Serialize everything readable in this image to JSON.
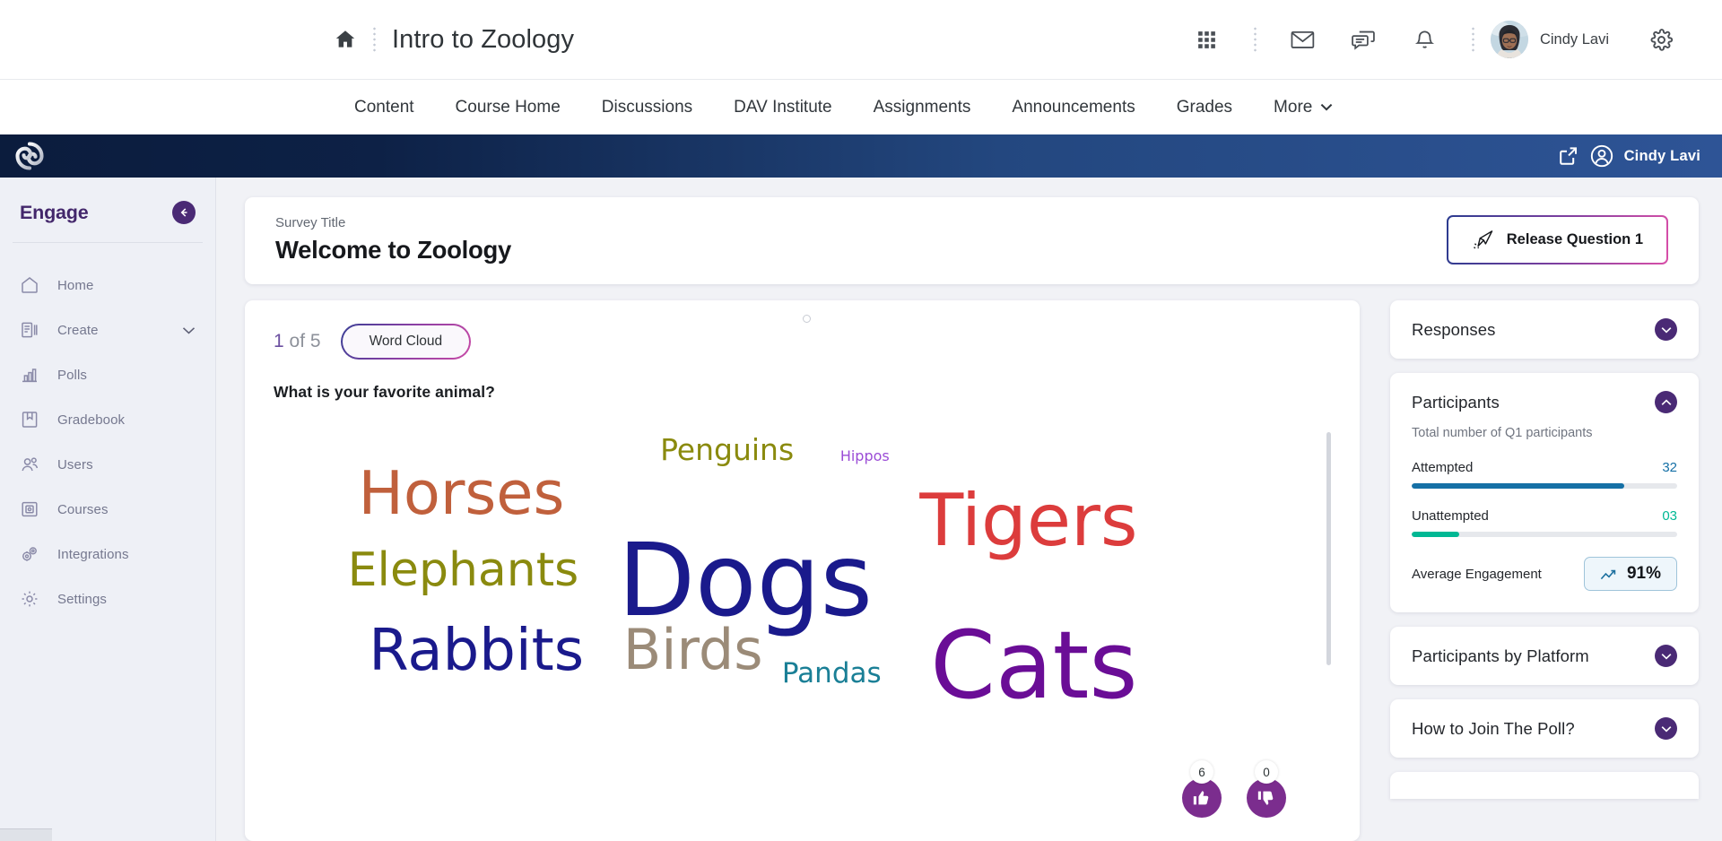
{
  "lms_header": {
    "home_icon": "home-icon",
    "course_title": "Intro to Zoology",
    "icons": [
      "waffle-grid-icon",
      "envelope-icon",
      "chat-bubbles-icon",
      "bell-icon"
    ],
    "user_name": "Cindy Lavi",
    "settings_icon": "gear-icon"
  },
  "nav": {
    "items": [
      {
        "label": "Content"
      },
      {
        "label": "Course Home"
      },
      {
        "label": "Discussions"
      },
      {
        "label": "DAV Institute"
      },
      {
        "label": "Assignments"
      },
      {
        "label": "Announcements"
      },
      {
        "label": "Grades"
      },
      {
        "label": "More"
      }
    ]
  },
  "engage_bar": {
    "logo": "engage-swirl-logo",
    "external_link_icon": "external-link-icon",
    "user_icon": "user-circle-icon",
    "user_name": "Cindy Lavi"
  },
  "sidebar": {
    "title": "Engage",
    "collapse_icon": "arrow-left-icon",
    "items": [
      {
        "label": "Home",
        "icon": "house-icon"
      },
      {
        "label": "Create",
        "icon": "create-document-icon",
        "chevron": true
      },
      {
        "label": "Polls",
        "icon": "bar-chart-icon"
      },
      {
        "label": "Gradebook",
        "icon": "book-bookmark-icon"
      },
      {
        "label": "Users",
        "icon": "users-icon"
      },
      {
        "label": "Courses",
        "icon": "courses-frame-icon"
      },
      {
        "label": "Integrations",
        "icon": "gears-icon"
      },
      {
        "label": "Settings",
        "icon": "gear-icon"
      }
    ]
  },
  "survey": {
    "label": "Survey Title",
    "name": "Welcome to Zoology",
    "release_button": "Release Question 1",
    "release_icon": "paper-plane-icon"
  },
  "question": {
    "index_current": "1",
    "index_rest": "of 5",
    "type_pill": "Word Cloud",
    "text": "What is your favorite animal?",
    "thumbs_up_count": "6",
    "thumbs_down_count": "0",
    "thumbs_up_icon": "thumbs-up-icon",
    "thumbs_down_icon": "thumbs-down-icon"
  },
  "chart_data": {
    "type": "wordcloud",
    "title": "What is your favorite animal?",
    "words": [
      {
        "text": "Dogs",
        "weight": 100,
        "color": "#1a1a8c",
        "size": 112,
        "x": 32.5,
        "y": 30
      },
      {
        "text": "Cats",
        "weight": 95,
        "color": "#6a0d96",
        "size": 104,
        "x": 62,
        "y": 51
      },
      {
        "text": "Tigers",
        "weight": 72,
        "color": "#dc3c3c",
        "size": 80,
        "x": 61,
        "y": 19
      },
      {
        "text": "Horses",
        "weight": 60,
        "color": "#c0603c",
        "size": 67,
        "x": 8,
        "y": 14
      },
      {
        "text": "Rabbits",
        "weight": 58,
        "color": "#1a1a8c",
        "size": 64,
        "x": 9,
        "y": 52
      },
      {
        "text": "Birds",
        "weight": 56,
        "color": "#9b8b78",
        "size": 62,
        "x": 33,
        "y": 52
      },
      {
        "text": "Elephants",
        "weight": 48,
        "color": "#8a8a0e",
        "size": 52,
        "x": 7,
        "y": 34
      },
      {
        "text": "Penguins",
        "weight": 30,
        "color": "#8a8a0e",
        "size": 33,
        "x": 36.5,
        "y": 7
      },
      {
        "text": "Pandas",
        "weight": 28,
        "color": "#1a7f96",
        "size": 31,
        "x": 48,
        "y": 61
      },
      {
        "text": "Hippos",
        "weight": 14,
        "color": "#9b4dd6",
        "size": 16,
        "x": 53.5,
        "y": 10.5
      }
    ]
  },
  "rail": {
    "responses": {
      "title": "Responses",
      "toggle_icon": "chevron-down-icon",
      "expanded": false
    },
    "participants": {
      "title": "Participants",
      "toggle_icon": "chevron-up-icon",
      "expanded": true,
      "subtitle": "Total number of Q1 participants",
      "stats": [
        {
          "label": "Attempted",
          "value": "32",
          "percent": 80,
          "color": "#1570a6"
        },
        {
          "label": "Unattempted",
          "value": "03",
          "percent": 18,
          "color": "#00b894"
        }
      ],
      "engagement_label": "Average Engagement",
      "engagement_value": "91%",
      "engagement_icon": "trend-up-icon"
    },
    "platform": {
      "title": "Participants by Platform",
      "toggle_icon": "chevron-down-icon"
    },
    "join": {
      "title": "How to Join The Poll?",
      "toggle_icon": "chevron-down-icon"
    }
  }
}
